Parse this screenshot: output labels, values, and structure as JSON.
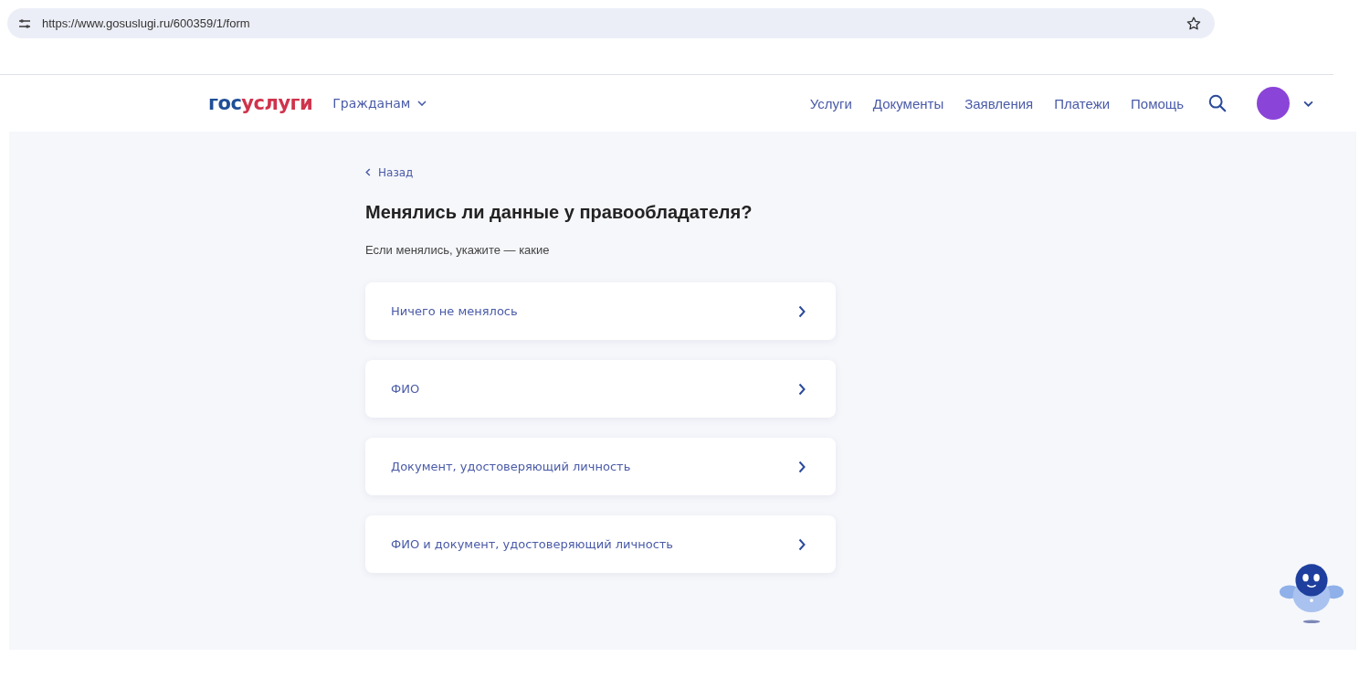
{
  "browser": {
    "url": "https://www.gosuslugi.ru/600359/1/form"
  },
  "header": {
    "logo": {
      "first": "гос",
      "second": "услуги"
    },
    "audience": "Гражданам",
    "nav": [
      "Услуги",
      "Документы",
      "Заявления",
      "Платежи",
      "Помощь"
    ]
  },
  "back": "Назад",
  "title": "Менялись ли данные у правообладателя?",
  "subtitle": "Если менялись, укажите — какие",
  "options": [
    {
      "label": "Ничего не менялось"
    },
    {
      "label": "ФИО"
    },
    {
      "label": "Документ, удостоверяющий личность"
    },
    {
      "label": "ФИО и документ, удостоверяющий личность"
    }
  ]
}
